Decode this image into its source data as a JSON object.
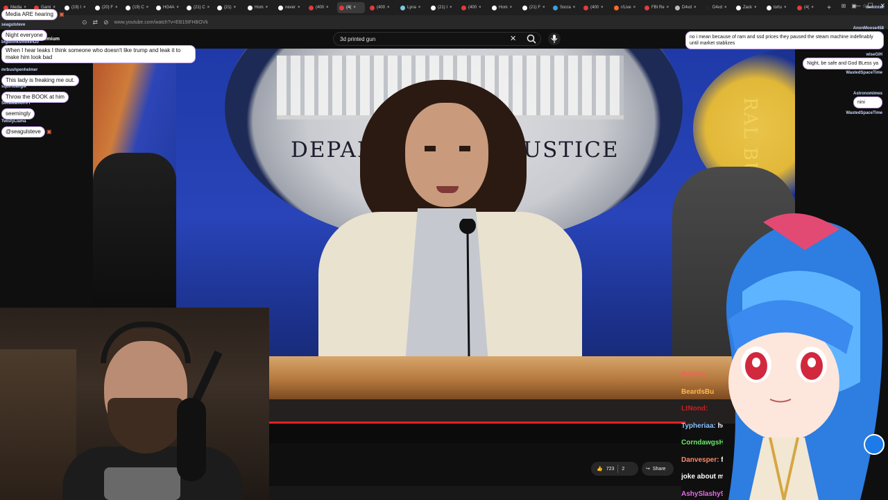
{
  "browser": {
    "tabs": [
      {
        "label": "Media",
        "color": "#e23b3b",
        "active": false
      },
      {
        "label": "Gami",
        "color": "#e23b3b",
        "active": false
      },
      {
        "label": "(19) I",
        "color": "#ffffff",
        "active": false
      },
      {
        "label": "(20) F",
        "color": "#ffffff",
        "active": false
      },
      {
        "label": "(19) C",
        "color": "#ffffff",
        "active": false
      },
      {
        "label": "HG4A",
        "color": "#ffffff",
        "active": false
      },
      {
        "label": "(21) C",
        "color": "#ffffff",
        "active": false
      },
      {
        "label": "(21)",
        "color": "#ffffff",
        "active": false
      },
      {
        "label": "Hom",
        "color": "#ffffff",
        "active": false
      },
      {
        "label": "never",
        "color": "#ffffff",
        "active": false
      },
      {
        "label": "(400",
        "color": "#e23b3b",
        "active": false
      },
      {
        "label": "(4(",
        "color": "#e23b3b",
        "active": true
      },
      {
        "label": "(400",
        "color": "#e23b3b",
        "active": false
      },
      {
        "label": "Lyna",
        "color": "#7ec8e3",
        "active": false
      },
      {
        "label": "(21) I",
        "color": "#ffffff",
        "active": false
      },
      {
        "label": "(400",
        "color": "#e23b3b",
        "active": false
      },
      {
        "label": "Hom",
        "color": "#ffffff",
        "active": false
      },
      {
        "label": "(21) F",
        "color": "#ffffff",
        "active": false
      },
      {
        "label": "Socra",
        "color": "#3aa0e2",
        "active": false
      },
      {
        "label": "(400",
        "color": "#e23b3b",
        "active": false
      },
      {
        "label": "r/Live",
        "color": "#ff6a2a",
        "active": false
      },
      {
        "label": "FBI Re",
        "color": "#e23b3b",
        "active": false
      },
      {
        "label": "D4vd",
        "color": "#bbbbbb",
        "active": false
      },
      {
        "label": "D4vd",
        "color": "#222222",
        "active": false
      },
      {
        "label": "Zack",
        "color": "#ffffff",
        "active": false
      },
      {
        "label": "tortu",
        "color": "#ffffff",
        "active": false
      },
      {
        "label": "(4(",
        "color": "#e23b3b",
        "active": false
      }
    ],
    "address": "www.youtube.com/watch?v=EB15tFHBOVk"
  },
  "youtube": {
    "search_value": "3d printed gun",
    "likes": "723",
    "dislikes": "2",
    "share_label": "Share"
  },
  "video": {
    "seal_text_left": "DEPART",
    "seal_text_right": "USTICE",
    "fbi_text": "RAL BUREA"
  },
  "left_chat": [
    {
      "user": "",
      "text": "Media ARE hearing",
      "emote": true
    },
    {
      "user": "seagulsteve",
      "text": "Night everyone",
      "emote": false
    },
    {
      "user": "bigdoinksmoke420",
      "text": "When I hear leaks I think someone who doesn't like trump and leak it to make him look bad",
      "emote": false
    },
    {
      "user": "mrbushpenhelmer",
      "text": "This lady is freaking me out.",
      "emote": false
    },
    {
      "user": "squirtdangle",
      "text": "Throw the BOOK at him",
      "emote": false
    },
    {
      "user": "SoraMamoriVT",
      "text": "seemingly",
      "emote": false
    },
    {
      "user": "TwistyLlama",
      "text": "@seagulsteve",
      "emote": true
    }
  ],
  "left_badge": "Premium",
  "right_chat": {
    "top_user": "deminisk",
    "msg1_user": "AnonMoose458",
    "msg1": "no i mean because of ram and ssd prices they paused the steam machine indefinably until market stablizes",
    "msg2_user": "wiseGlH",
    "msg2": "Night, be safe and God BLess ya",
    "user3": "WastedSpaceTime",
    "user4": "Astronomimes",
    "msg4": "nini",
    "user5": "WastedSpaceTime"
  },
  "yt_chat": [
    {
      "user": "Politele",
      "color": "#ff5b5b",
      "msg": ""
    },
    {
      "user": "BeardsBu",
      "color": "#ffb84a",
      "msg": ""
    },
    {
      "user": "LtNond:",
      "color": "#c82020",
      "msg": ""
    },
    {
      "user": "Typheriaa:",
      "color": "#8ec5ff",
      "msg": "he wants your"
    },
    {
      "user": "CorndawgsHat",
      "color": "#68e868",
      "msg": ""
    },
    {
      "user": "Danvesper:",
      "color": "#ff8a6a",
      "msg": "for"
    },
    {
      "user": "",
      "color": "#ffffff",
      "msg": "joke about m"
    },
    {
      "user": "AshySlashy9",
      "color": "#e86ae8",
      "msg": ""
    }
  ]
}
